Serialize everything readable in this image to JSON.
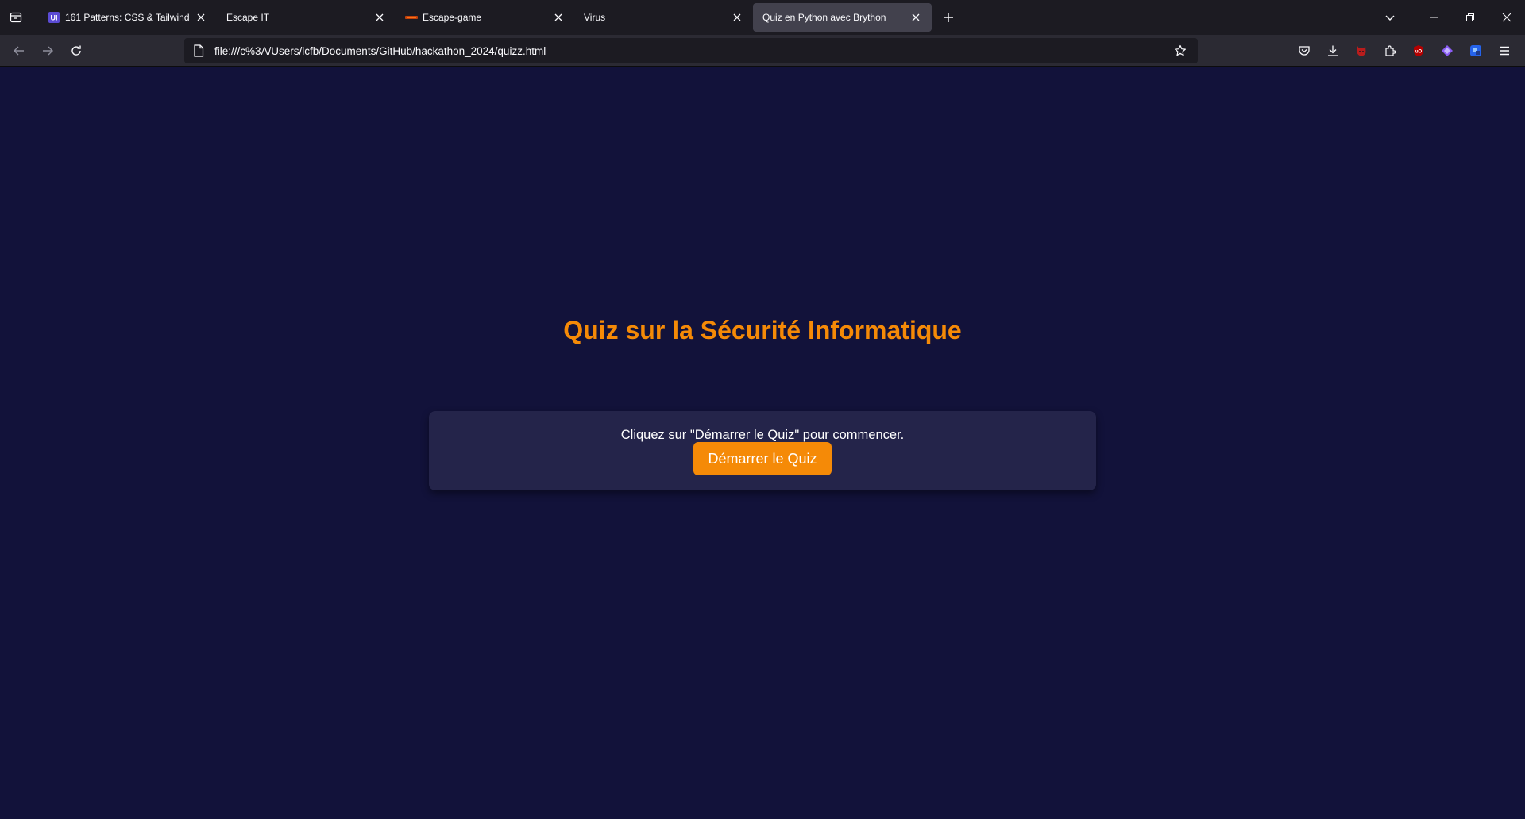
{
  "browser": {
    "tabs": [
      {
        "title": "161 Patterns: CSS & Tailwind",
        "icon": "ui-patterns-favicon",
        "active": false
      },
      {
        "title": "Escape IT",
        "icon": "",
        "active": false
      },
      {
        "title": "Escape-game",
        "icon": "escape-game-favicon",
        "active": false
      },
      {
        "title": "Virus",
        "icon": "",
        "active": false
      },
      {
        "title": "Quiz en Python avec Brython",
        "icon": "",
        "active": true
      }
    ],
    "url": "file:///c%3A/Users/lcfb/Documents/GitHub/hackathon_2024/quizz.html",
    "toolbar_icons": [
      "pocket-icon",
      "download-icon",
      "extension-devil-icon",
      "extensions-icon",
      "ublock-icon",
      "extension-purple-icon",
      "extension-blue-icon",
      "menu-icon"
    ]
  },
  "page": {
    "title": "Quiz sur la Sécurité Informatique",
    "instructions": "Cliquez sur \"Démarrer le Quiz\" pour commencer.",
    "start_button": "Démarrer le Quiz"
  },
  "colors": {
    "background": "#12123a",
    "card": "#24244a",
    "accent": "#f58a07",
    "text": "#ffffff"
  }
}
